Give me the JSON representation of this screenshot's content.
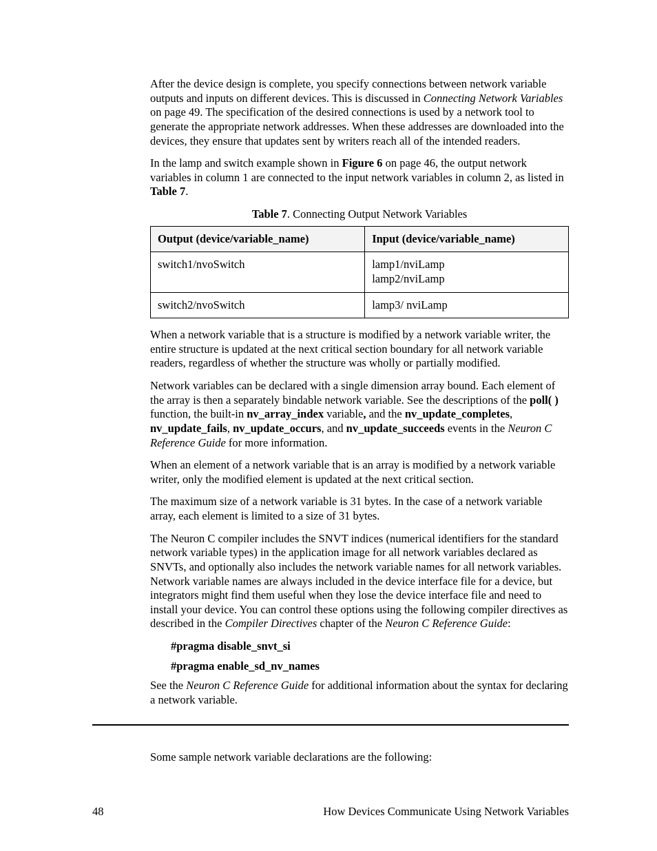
{
  "p1_a": "After the device design is complete, you specify connections between network variable outputs and inputs on different devices.  This is discussed in ",
  "p1_i": "Connecting Network Variables",
  "p1_b": " on page 49.  The specification of the desired connections is used by a network tool to generate the appropriate network addresses.  When these addresses are downloaded into the devices, they ensure that updates sent by writers reach all of the intended readers.",
  "p2_a": "In the lamp and switch example shown in ",
  "p2_b1": "Figure 6",
  "p2_c": " on page 46, the output network variables in column 1 are connected to the input network variables in column 2, as listed in ",
  "p2_b2": "Table 7",
  "p2_d": ".",
  "table_caption_b": "Table 7",
  "table_caption_r": ". Connecting Output Network Variables",
  "th1": "Output (device/variable_name)",
  "th2": "Input (device/variable_name)",
  "r1c1": "switch1/nvoSwitch",
  "r1c2a": "lamp1/nviLamp",
  "r1c2b": "lamp2/nviLamp",
  "r2c1": "switch2/nvoSwitch",
  "r2c2": "lamp3/ nviLamp",
  "p3": "When a network variable that is a structure is modified by a network variable writer, the entire structure is updated at the next critical section boundary for all network variable readers, regardless of whether the structure was wholly or partially modified.",
  "p4_a": "Network variables can be declared with a single dimension array bound.  Each element of the array is then a separately bindable network variable.  See the descriptions of the ",
  "p4_poll": "poll( )",
  "p4_b": " function, the built-in ",
  "p4_nvai": "nv_array_index",
  "p4_c": " variable",
  "p4_comma": ",",
  "p4_d": " and the ",
  "p4_nuc": "nv_update_completes",
  "p4_e": ", ",
  "p4_nuf": "nv_update_fails",
  "p4_f": ", ",
  "p4_nuo": "nv_update_occurs",
  "p4_g": ", and ",
  "p4_nus": "nv_update_succeeds",
  "p4_h": " events in the ",
  "p4_guide": "Neuron C Reference Guide",
  "p4_i": " for more information.",
  "p5": "When an element of a network variable that is an array is modified by a network variable writer, only the modified element is updated at the next critical section.",
  "p6": "The maximum size of a network variable is 31 bytes.  In the case of a network variable array, each element is limited to a size of 31 bytes.",
  "p7_a": "The Neuron C compiler includes the SNVT indices (numerical identifiers for the standard network variable types) in the application image for all network variables declared as SNVTs, and optionally also includes the network variable names for all network variables.  Network variable names are always included in the device interface file for a device, but integrators might find them useful when they lose the device interface file and need to install your device.  You can control these options using the following compiler directives as described in the ",
  "p7_i1": "Compiler Directives",
  "p7_b": " chapter of the ",
  "p7_i2": "Neuron C Reference Guide",
  "p7_c": ":",
  "pragma1": "#pragma disable_snvt_si",
  "pragma2": "#pragma enable_sd_nv_names",
  "p8_a": "See the ",
  "p8_i": "Neuron C Reference Guide",
  "p8_b": " for additional information about the syntax for declaring a network variable.",
  "p9": "Some sample network variable declarations are the following:",
  "footer_page": "48",
  "footer_title": "How Devices Communicate Using Network Variables"
}
